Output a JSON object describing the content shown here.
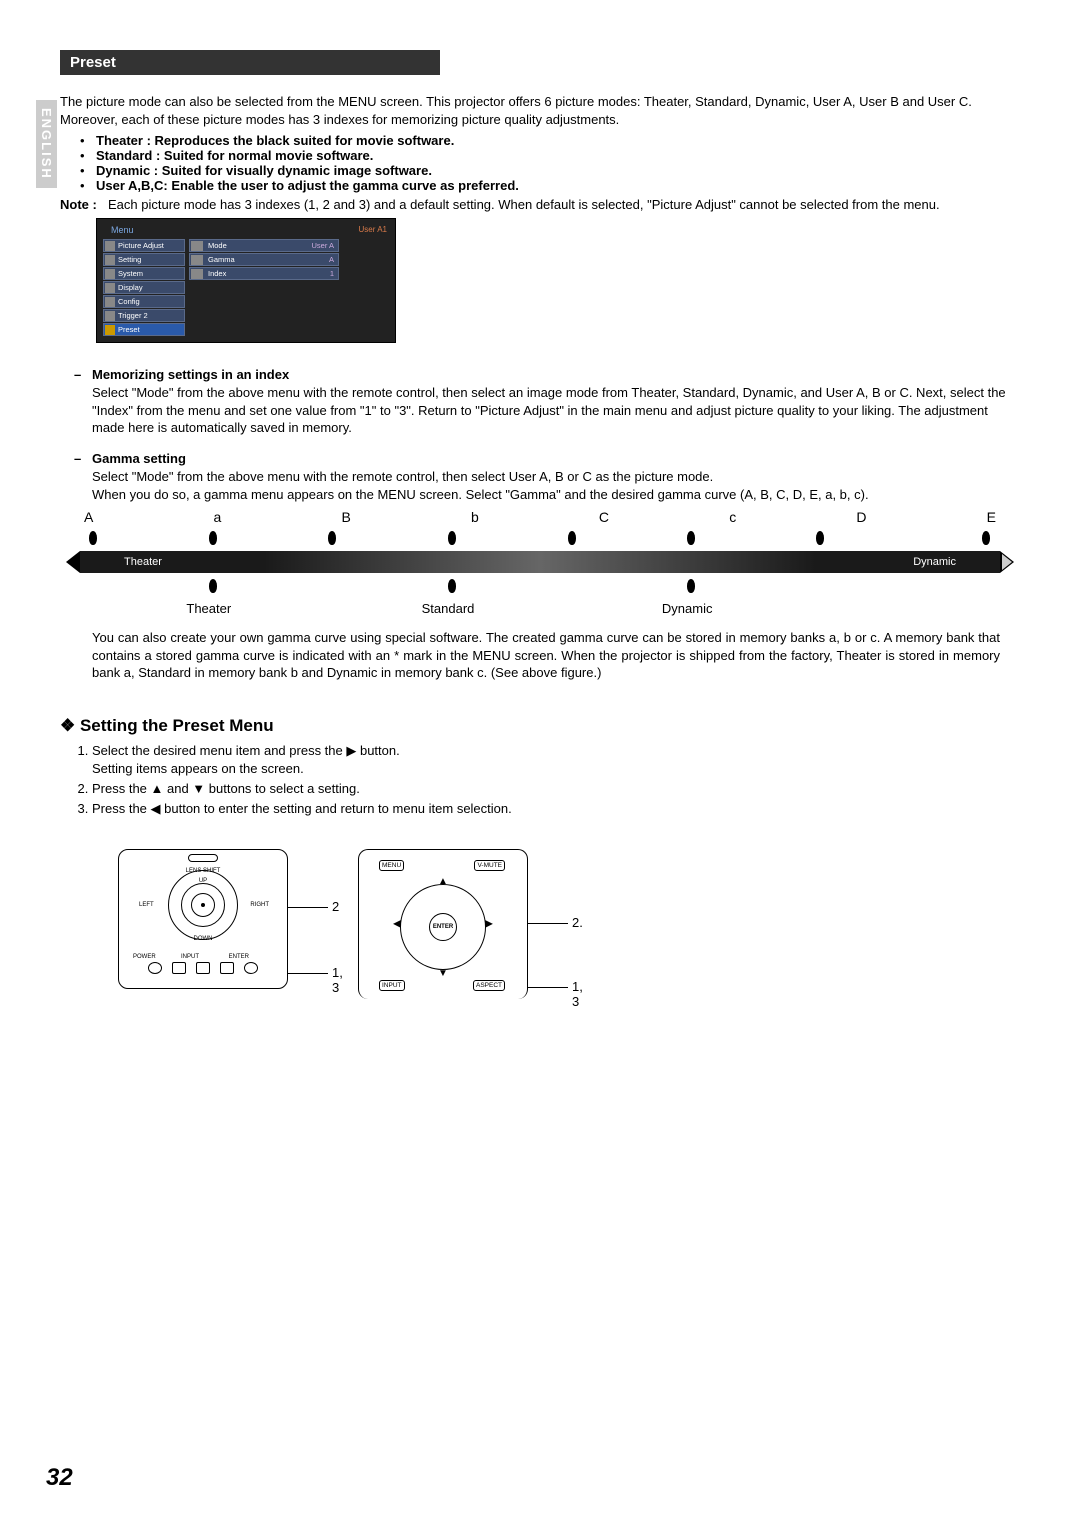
{
  "lang_tab": "ENGLISH",
  "section_title": "Preset",
  "intro": "The picture mode can also be selected from the MENU screen. This projector offers 6 picture modes: Theater, Standard, Dynamic, User A, User B and User C. Moreover, each of these picture modes has 3 indexes for memorizing picture quality adjustments.",
  "bullets": [
    "Theater :    Reproduces the black suited for movie software.",
    "Standard :  Suited for normal movie software.",
    "Dynamic :   Suited for visually dynamic image software.",
    "User A,B,C:    Enable the user to adjust the gamma curve as preferred."
  ],
  "note_label": "Note :",
  "note_text": "Each picture mode has 3 indexes (1, 2 and 3) and a default setting. When default is selected, \"Picture Adjust\" cannot be selected from the menu.",
  "menu_mock": {
    "title": "Menu",
    "corner": "User A1",
    "left_items": [
      "Picture Adjust",
      "Setting",
      "System",
      "Display",
      "Config",
      "Trigger 2",
      "Preset"
    ],
    "selected_left": "Preset",
    "right_rows": [
      {
        "label": "Mode",
        "value": "User A"
      },
      {
        "label": "Gamma",
        "value": "A"
      },
      {
        "label": "Index",
        "value": "1"
      }
    ]
  },
  "sub_memorizing_title": "Memorizing settings in an index",
  "sub_memorizing_body": "Select \"Mode\" from the above menu with the remote control, then select an image mode from Theater, Standard, Dynamic, and User A, B or C. Next, select the \"Index\" from the menu and set one value from \"1\" to \"3\".  Return to \"Picture Adjust\" in the main menu and adjust picture quality to your liking. The adjustment made here is automatically saved in memory.",
  "sub_gamma_title": "Gamma setting",
  "sub_gamma_body": "Select \"Mode\" from the above menu with the remote control, then select User A, B or C as the picture mode.\nWhen you do so, a gamma menu appears on the MENU screen. Select \"Gamma\" and the desired gamma curve (A, B, C, D, E, a, b, c).",
  "gamma": {
    "top_labels": [
      "A",
      "a",
      "B",
      "b",
      "C",
      "c",
      "D",
      "E"
    ],
    "bar_left": "Theater",
    "bar_right": "Dynamic",
    "bottom_labels": [
      "Theater",
      "Standard",
      "Dynamic"
    ]
  },
  "gamma_follow": "You can also create your own gamma curve using special software. The created gamma curve can be stored in memory banks a, b or c. A memory bank that contains a stored gamma curve is indicated with an * mark in the MENU screen. When the projector is shipped from the factory, Theater is stored in memory bank a, Standard in memory bank b and Dynamic in memory bank c. (See above figure.)",
  "heading2": "Setting the Preset Menu",
  "steps": [
    "Select the desired menu item and press the ▶ button.\nSetting items appears on the screen.",
    "Press the ▲ and ▼ buttons to select a setting.",
    "Press the ◀ button to enter the setting and return to menu item selection."
  ],
  "diag_labels": {
    "proj_top": "2",
    "proj_bot": "1, 3",
    "rem_top": "2.",
    "rem_bot": "1, 3",
    "proj_tiny": {
      "lens": "LENS SHIFT",
      "up": "UP",
      "left": "LEFT",
      "right": "RIGHT",
      "down": "DOWN",
      "power": "POWER",
      "input": "INPUT",
      "enter": "ENTER"
    },
    "rem_btn": {
      "menu": "MENU",
      "vmute": "V-MUTE",
      "input": "INPUT",
      "aspect": "ASPECT",
      "enter": "ENTER"
    }
  },
  "page_number": "32"
}
